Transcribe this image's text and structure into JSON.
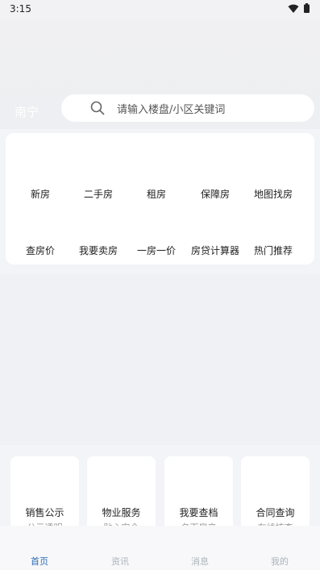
{
  "status_bar": {
    "time": "3:15"
  },
  "header": {
    "city": "南宁",
    "search": {
      "placeholder": "请输入楼盘/小区关键词"
    }
  },
  "menu": {
    "row1": [
      "新房",
      "二手房",
      "租房",
      "保障房",
      "地图找房"
    ],
    "row2": [
      "查房价",
      "我要卖房",
      "一房一价",
      "房贷计算器",
      "热门推荐"
    ]
  },
  "services": [
    {
      "title": "销售公示",
      "subtitle": "公示透明"
    },
    {
      "title": "物业服务",
      "subtitle": "贴心安全"
    },
    {
      "title": "我要查档",
      "subtitle": "名下房产"
    },
    {
      "title": "合同查询",
      "subtitle": "在线核查"
    }
  ],
  "bottom_nav": {
    "tabs": [
      "首页",
      "资讯",
      "消息",
      "我的"
    ],
    "active_index": 0,
    "active_color": "#2e6db4",
    "inactive_color": "#a8b4b8"
  }
}
